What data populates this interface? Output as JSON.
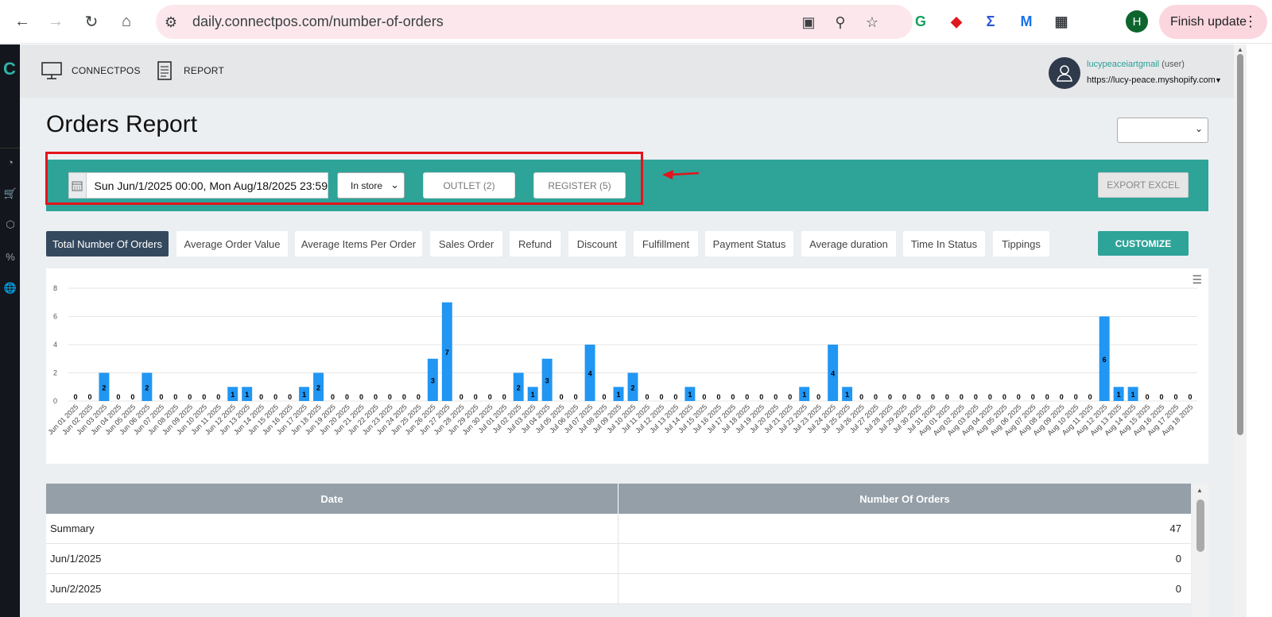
{
  "browser": {
    "url": "daily.connectpos.com/number-of-orders",
    "profile_initial": "H",
    "finish_update": "Finish update"
  },
  "app": {
    "logo": "C",
    "nav": {
      "connectpos": "CONNECTPOS",
      "report": "REPORT"
    },
    "user": {
      "name": "lucypeaceiartgmail",
      "role": "(user)",
      "shop": "https://lucy-peace.myshopify.com"
    }
  },
  "page": {
    "title": "Orders Report"
  },
  "filters": {
    "date_range": "Sun Jun/1/2025 00:00, Mon Aug/18/2025 23:59",
    "channel": "In store",
    "outlet": "OUTLET (2)",
    "register": "REGISTER (5)",
    "export": "EXPORT EXCEL"
  },
  "tabs": [
    {
      "label": "Total Number Of Orders",
      "active": true
    },
    {
      "label": "Average Order Value"
    },
    {
      "label": "Average Items Per Order"
    },
    {
      "label": "Sales Order"
    },
    {
      "label": "Refund"
    },
    {
      "label": "Discount"
    },
    {
      "label": "Fulfillment"
    },
    {
      "label": "Payment Status"
    },
    {
      "label": "Average duration"
    },
    {
      "label": "Time In Status"
    },
    {
      "label": "Tippings"
    }
  ],
  "customize": "CUSTOMIZE",
  "chart_data": {
    "type": "bar",
    "ylim": [
      0,
      8
    ],
    "yticks": [
      0,
      2,
      4,
      6,
      8
    ],
    "bar_color": "#2196f3",
    "grid": true,
    "categories": [
      "Jun 01 2025",
      "Jun 02 2025",
      "Jun 03 2025",
      "Jun 04 2025",
      "Jun 05 2025",
      "Jun 06 2025",
      "Jun 07 2025",
      "Jun 08 2025",
      "Jun 09 2025",
      "Jun 10 2025",
      "Jun 11 2025",
      "Jun 12 2025",
      "Jun 13 2025",
      "Jun 14 2025",
      "Jun 15 2025",
      "Jun 16 2025",
      "Jun 17 2025",
      "Jun 18 2025",
      "Jun 19 2025",
      "Jun 20 2025",
      "Jun 21 2025",
      "Jun 22 2025",
      "Jun 23 2025",
      "Jun 24 2025",
      "Jun 25 2025",
      "Jun 26 2025",
      "Jun 27 2025",
      "Jun 28 2025",
      "Jun 29 2025",
      "Jun 30 2025",
      "Jul 01 2025",
      "Jul 02 2025",
      "Jul 03 2025",
      "Jul 04 2025",
      "Jul 05 2025",
      "Jul 06 2025",
      "Jul 07 2025",
      "Jul 08 2025",
      "Jul 09 2025",
      "Jul 10 2025",
      "Jul 11 2025",
      "Jul 12 2025",
      "Jul 13 2025",
      "Jul 14 2025",
      "Jul 15 2025",
      "Jul 16 2025",
      "Jul 17 2025",
      "Jul 18 2025",
      "Jul 19 2025",
      "Jul 20 2025",
      "Jul 21 2025",
      "Jul 22 2025",
      "Jul 23 2025",
      "Jul 24 2025",
      "Jul 25 2025",
      "Jul 26 2025",
      "Jul 27 2025",
      "Jul 28 2025",
      "Jul 29 2025",
      "Jul 30 2025",
      "Jul 31 2025",
      "Aug 01 2025",
      "Aug 02 2025",
      "Aug 03 2025",
      "Aug 04 2025",
      "Aug 05 2025",
      "Aug 06 2025",
      "Aug 07 2025",
      "Aug 08 2025",
      "Aug 09 2025",
      "Aug 10 2025",
      "Aug 11 2025",
      "Aug 12 2025",
      "Aug 13 2025",
      "Aug 14 2025",
      "Aug 15 2025",
      "Aug 16 2025",
      "Aug 17 2025",
      "Aug 18 2025"
    ],
    "values": [
      0,
      0,
      2,
      0,
      0,
      2,
      0,
      0,
      0,
      0,
      0,
      1,
      1,
      0,
      0,
      0,
      1,
      2,
      0,
      0,
      0,
      0,
      0,
      0,
      0,
      3,
      7,
      0,
      0,
      0,
      0,
      2,
      1,
      3,
      0,
      0,
      4,
      0,
      1,
      2,
      0,
      0,
      0,
      1,
      0,
      0,
      0,
      0,
      0,
      0,
      0,
      1,
      0,
      4,
      1,
      0,
      0,
      0,
      0,
      0,
      0,
      0,
      0,
      0,
      0,
      0,
      0,
      0,
      0,
      0,
      0,
      0,
      6,
      1,
      1,
      0,
      0,
      0,
      0
    ]
  },
  "table": {
    "headers": [
      "Date",
      "Number Of Orders"
    ],
    "rows": [
      {
        "date": "Summary",
        "count": "47"
      },
      {
        "date": "Jun/1/2025",
        "count": "0"
      },
      {
        "date": "Jun/2/2025",
        "count": "0"
      }
    ]
  }
}
